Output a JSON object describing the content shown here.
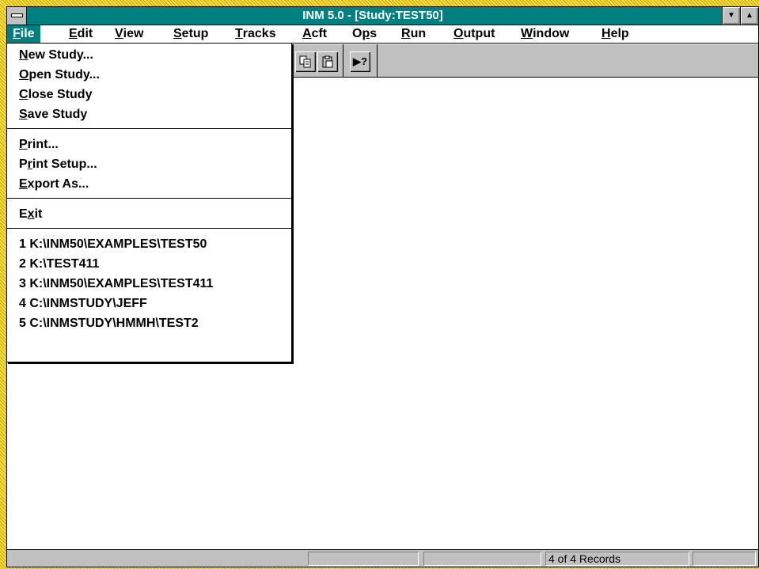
{
  "window": {
    "title": "INM 5.0 - [Study:TEST50]",
    "minimize_glyph": "▼",
    "maximize_glyph": "▲"
  },
  "menubar": [
    {
      "pre": "",
      "acc": "F",
      "post": "ile"
    },
    {
      "pre": "",
      "acc": "E",
      "post": "dit"
    },
    {
      "pre": "",
      "acc": "V",
      "post": "iew"
    },
    {
      "pre": "",
      "acc": "S",
      "post": "etup"
    },
    {
      "pre": "",
      "acc": "T",
      "post": "racks"
    },
    {
      "pre": "",
      "acc": "A",
      "post": "cft"
    },
    {
      "pre": "O",
      "acc": "p",
      "post": "s"
    },
    {
      "pre": "",
      "acc": "R",
      "post": "un"
    },
    {
      "pre": "",
      "acc": "O",
      "post": "utput"
    },
    {
      "pre": "",
      "acc": "W",
      "post": "indow"
    },
    {
      "pre": "",
      "acc": "H",
      "post": "elp"
    }
  ],
  "toolbar": {
    "icons": [
      "copy-icon",
      "paste-icon",
      "context-help-icon"
    ],
    "help_glyph": "▶?"
  },
  "file_menu": {
    "group1": [
      {
        "pre": "",
        "acc": "N",
        "post": "ew Study..."
      },
      {
        "pre": "",
        "acc": "O",
        "post": "pen Study..."
      },
      {
        "pre": "",
        "acc": "C",
        "post": "lose Study"
      },
      {
        "pre": "",
        "acc": "S",
        "post": "ave Study"
      }
    ],
    "group2": [
      {
        "pre": "",
        "acc": "P",
        "post": "rint..."
      },
      {
        "pre": "P",
        "acc": "r",
        "post": "int Setup..."
      },
      {
        "pre": "",
        "acc": "E",
        "post": "xport As..."
      }
    ],
    "group3": [
      {
        "pre": "E",
        "acc": "x",
        "post": "it"
      }
    ],
    "recent": [
      "1 K:\\INM50\\EXAMPLES\\TEST50",
      "2 K:\\TEST411",
      "3 K:\\INM50\\EXAMPLES\\TEST411",
      "4 C:\\INMSTUDY\\JEFF",
      "5 C:\\INMSTUDY\\HMMH\\TEST2"
    ]
  },
  "statusbar": {
    "records": "4 of 4 Records"
  },
  "colors": {
    "titlebar": "#008080",
    "chrome": "#c0c0c0",
    "frame": "#f5dc4a"
  }
}
